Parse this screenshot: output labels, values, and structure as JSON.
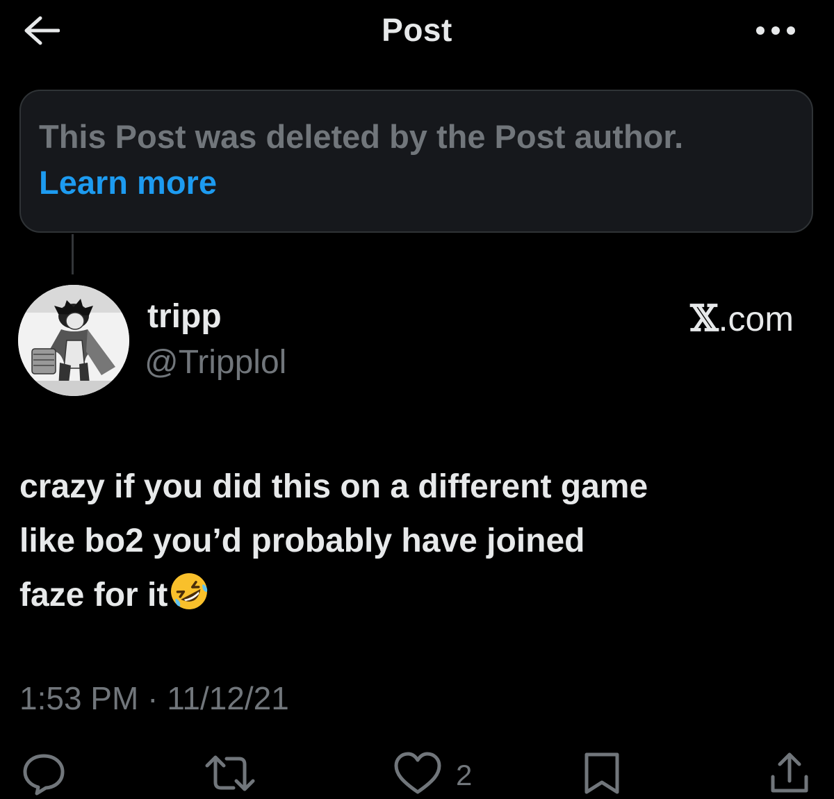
{
  "header": {
    "title": "Post",
    "back_icon": "arrow-left-icon",
    "more_icon": "more-horizontal-icon"
  },
  "deleted_notice": {
    "message": "This Post was deleted by the Post author.",
    "link_label": "Learn more"
  },
  "author": {
    "display_name": "tripp",
    "handle": "@Tripplol",
    "source_glyph": "𝕏",
    "source_suffix": ".com"
  },
  "post": {
    "lines": [
      "crazy if you did this on a different game",
      "like bo2 you’d probably have joined",
      "faze for it"
    ],
    "emoji": "rolling-on-floor-laughing-emoji",
    "timestamp": "1:53 PM · 11/12/21"
  },
  "actions": {
    "reply_icon": "reply-icon",
    "repost_icon": "repost-icon",
    "like_icon": "heart-icon",
    "like_count": "2",
    "bookmark_icon": "bookmark-icon",
    "share_icon": "share-icon"
  },
  "colors": {
    "background": "#000000",
    "primary_text": "#e7e9ea",
    "secondary_text": "#71767b",
    "link": "#1d9bf0",
    "notice_background": "#16181c",
    "border": "#2f3336"
  }
}
